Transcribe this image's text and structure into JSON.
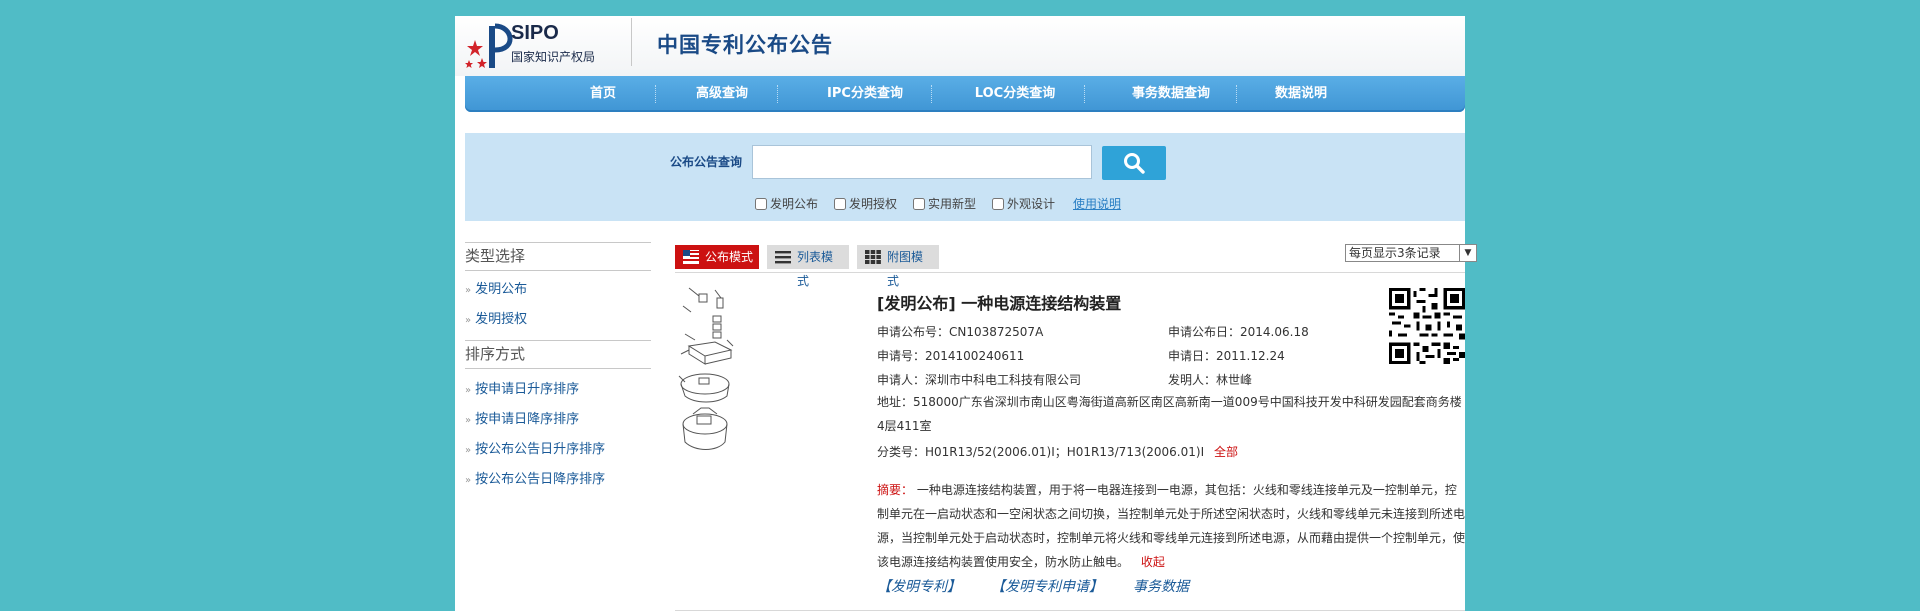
{
  "header": {
    "logo_text": "SIPO",
    "logo_sub": "国家知识产权局",
    "site_title": "中国专利公布公告"
  },
  "nav": {
    "items": [
      {
        "label": "首页"
      },
      {
        "label": "高级查询"
      },
      {
        "label": "IPC分类查询"
      },
      {
        "label": "LOC分类查询"
      },
      {
        "label": "事务数据查询"
      },
      {
        "label": "数据说明"
      }
    ]
  },
  "search": {
    "label": "公布公告查询",
    "value": "",
    "options": [
      "发明公布",
      "发明授权",
      "实用新型",
      "外观设计"
    ],
    "usage_link": "使用说明",
    "search_icon": "magnifier-icon"
  },
  "sidebar": {
    "type_heading": "类型选择",
    "type_items": [
      "发明公布",
      "发明授权"
    ],
    "sort_heading": "排序方式",
    "sort_items": [
      "按申请日升序排序",
      "按申请日降序排序",
      "按公布公告日升序排序",
      "按公布公告日降序排序"
    ]
  },
  "modes": {
    "publish": "公布模式",
    "list": "列表模式",
    "image": "附图模式",
    "per_page": "每页显示3条记录"
  },
  "record": {
    "title": "[发明公布] 一种电源连接结构装置",
    "pub_no": "申请公布号：CN103872507A",
    "pub_date": "申请公布日：2014.06.18",
    "app_no": "申请号：2014100240611",
    "app_date": "申请日：2011.12.24",
    "applicant": "申请人：深圳市中科电工科技有限公司",
    "inventor": "发明人：林世峰",
    "address": "地址：518000广东省深圳市南山区粤海街道高新区南区高新南一道009号中国科技开发中科研发园配套商务楼4层411室",
    "class_no": "分类号：H01R13/52(2006.01)I；H01R13/713(2006.01)I",
    "class_all": "全部",
    "abstract_label": "摘要：",
    "abstract_text": "一种电源连接结构装置，用于将一电器连接到一电源，其包括：火线和零线连接单元及一控制单元，控制单元在一启动状态和一空闲状态之间切换，当控制单元处于所述空闲状态时，火线和零线单元未连接到所述电源，当控制单元处于启动状态时，控制单元将火线和零线单元连接到所述电源，从而藉由提供一个控制单元，使该电源连接结构装置使用安全，防水防止触电。",
    "collapse": "收起",
    "links": [
      "【发明专利】",
      "【发明专利申请】",
      "事务数据"
    ]
  }
}
